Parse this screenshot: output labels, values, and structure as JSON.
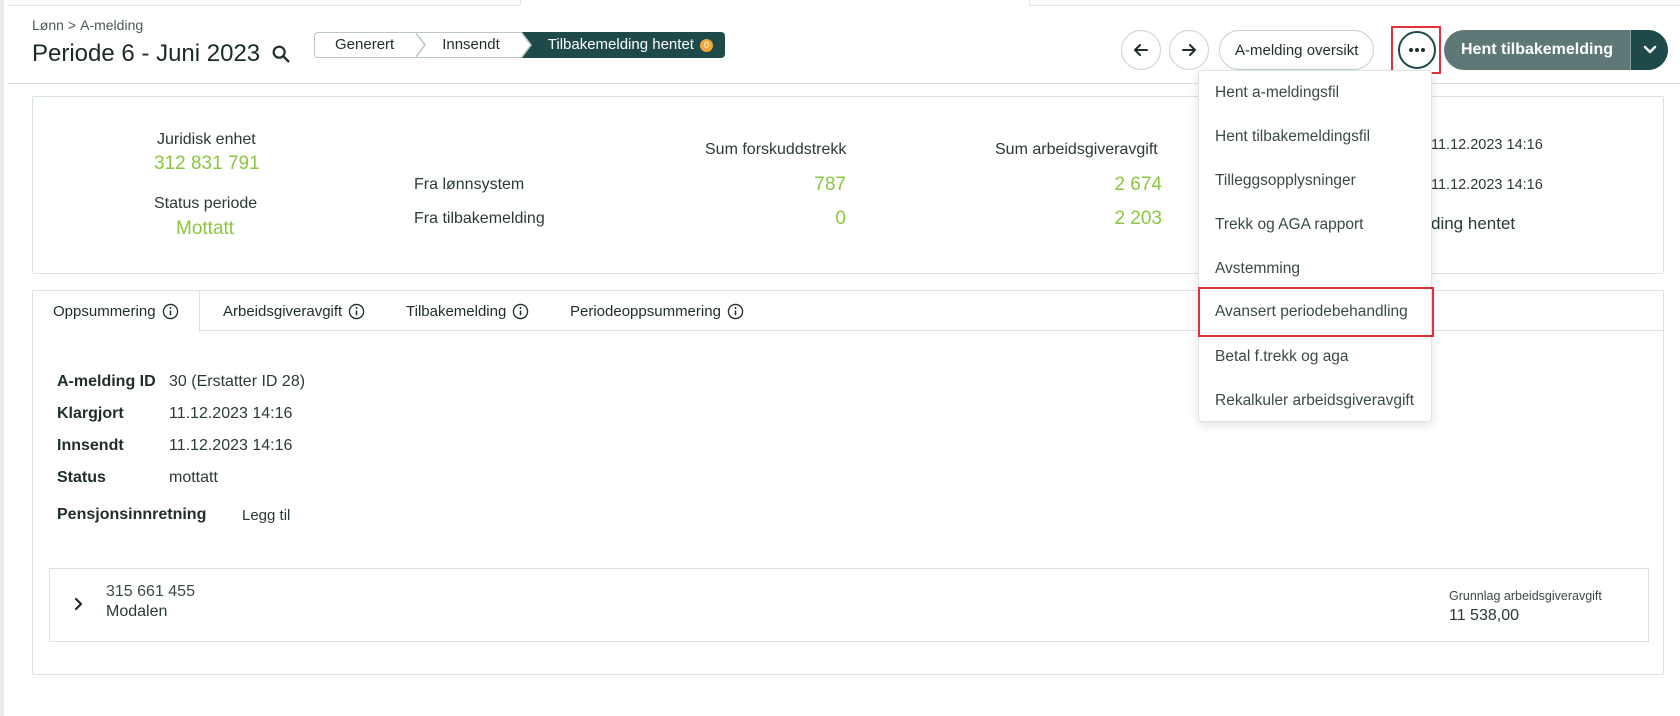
{
  "breadcrumb": {
    "root": "Lønn",
    "sep": ">",
    "current": "A-melding"
  },
  "page": {
    "title": "Periode 6 - Juni 2023"
  },
  "stepper": {
    "steps": [
      "Generert",
      "Innsendt",
      "Tilbakemelding hentet"
    ],
    "badge": "0"
  },
  "toolbar": {
    "overview_label": "A-melding oversikt",
    "primary_label": "Hent tilbakemelding"
  },
  "summary": {
    "legal_entity_label": "Juridisk enhet",
    "legal_entity_value": "312 831 791",
    "status_label": "Status periode",
    "status_value": "Mottatt",
    "col_forskudd": "Sum forskuddstrekk",
    "col_aga": "Sum arbeidsgiveravgift",
    "rows": [
      {
        "label": "Fra lønnsystem",
        "forskudd": "787",
        "aga": "2 674"
      },
      {
        "label": "Fra tilbakemelding",
        "forskudd": "0",
        "aga": "2 203"
      }
    ],
    "right_date1": "11.12.2023 14:16",
    "right_date2": "11.12.2023 14:16",
    "right_status": "ding hentet"
  },
  "tabs": [
    {
      "label": "Oppsummering"
    },
    {
      "label": "Arbeidsgiveravgift"
    },
    {
      "label": "Tilbakemelding"
    },
    {
      "label": "Periodeoppsummering"
    }
  ],
  "details": {
    "id_label": "A-melding ID",
    "id_value": "30 (Erstatter ID 28)",
    "klargjort_label": "Klargjort",
    "klargjort_value": "11.12.2023 14:16",
    "innsendt_label": "Innsendt",
    "innsendt_value": "11.12.2023 14:16",
    "status_label": "Status",
    "status_value": "mottatt",
    "pensjon_label": "Pensjonsinnretning",
    "pensjon_action": "Legg til"
  },
  "org": {
    "number": "315 661 455",
    "name": "Modalen",
    "grunnlag_label": "Grunnlag arbeidsgiveravgift",
    "grunnlag_value": "11 538,00"
  },
  "menu": {
    "items": [
      "Hent a-meldingsfil",
      "Hent tilbakemeldingsfil",
      "Tilleggsopplysninger",
      "Trekk og AGA rapport",
      "Avstemming",
      "Avansert periodebehandling",
      "Betal f.trekk og aga",
      "Rekalkuler arbeidsgiveravgift"
    ]
  },
  "colors": {
    "accent": "#1f4a4a",
    "green": "#8cc63f",
    "highlight": "#e0323a",
    "badge": "#f2a63a"
  }
}
